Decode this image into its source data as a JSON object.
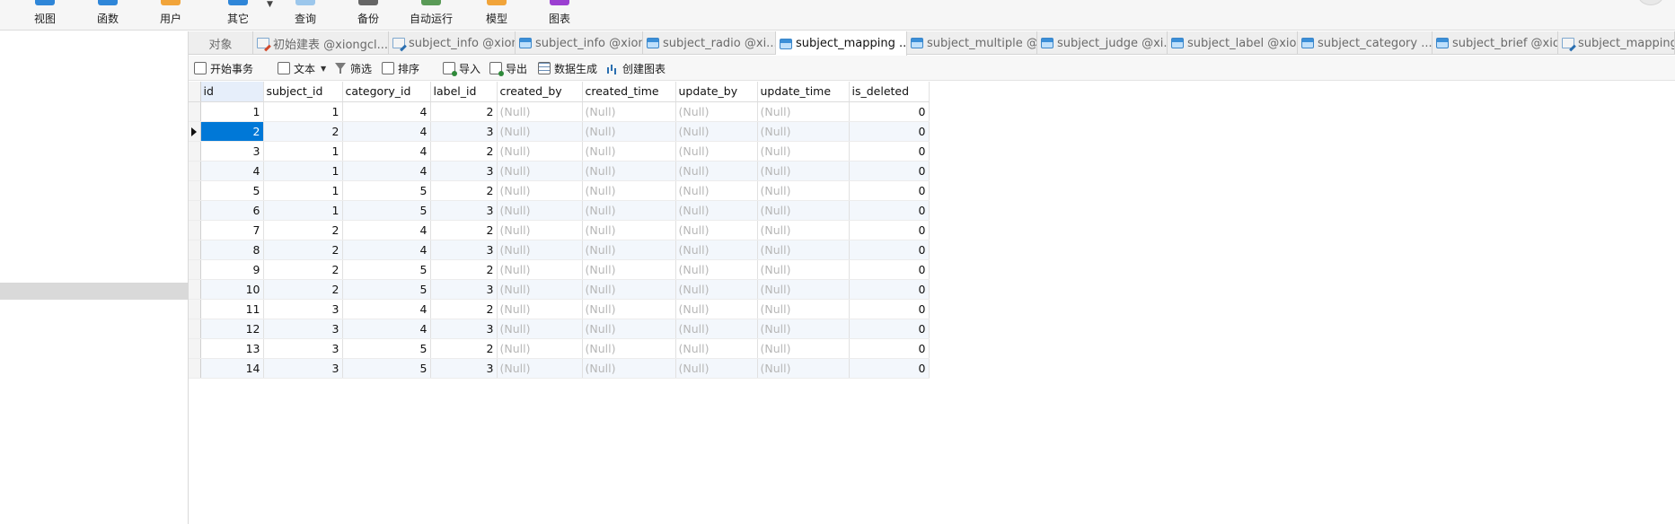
{
  "ribbon": {
    "buttons": [
      {
        "label": "视图",
        "icon": "view-icon",
        "color": "#2f86d8"
      },
      {
        "label": "函数",
        "icon": "function-icon",
        "color": "#2f86d8"
      },
      {
        "label": "用户",
        "icon": "user-icon",
        "color": "#f1a43a"
      },
      {
        "label": "其它",
        "icon": "other-icon",
        "color": "#2f86d8"
      },
      {
        "label": "查询",
        "icon": "query-icon",
        "color": "#9cc7ec"
      },
      {
        "label": "备份",
        "icon": "backup-icon",
        "color": "#666666"
      },
      {
        "label": "自动运行",
        "icon": "automation-icon",
        "color": "#5a9a57"
      },
      {
        "label": "模型",
        "icon": "model-icon",
        "color": "#f1a43a"
      },
      {
        "label": "图表",
        "icon": "chart-icon",
        "color": "#9b3fd1"
      }
    ]
  },
  "tabs": [
    {
      "label": "对象",
      "icon": "none"
    },
    {
      "label": "初始建表 @xiongcl...",
      "icon": "query-red"
    },
    {
      "label": "subject_info @xion...",
      "icon": "query"
    },
    {
      "label": "subject_info @xion...",
      "icon": "table"
    },
    {
      "label": "subject_radio @xi...",
      "icon": "table"
    },
    {
      "label": "subject_mapping ...",
      "icon": "table",
      "active": true
    },
    {
      "label": "subject_multiple @...",
      "icon": "table"
    },
    {
      "label": "subject_judge @xi...",
      "icon": "table"
    },
    {
      "label": "subject_label @xio...",
      "icon": "table"
    },
    {
      "label": "subject_category ...",
      "icon": "table"
    },
    {
      "label": "subject_brief @xio...",
      "icon": "table"
    },
    {
      "label": "subject_mapping ...",
      "icon": "query"
    }
  ],
  "toolbar": {
    "begin_transaction": "开始事务",
    "text": "文本",
    "filter": "筛选",
    "sort": "排序",
    "import": "导入",
    "export": "导出",
    "generate_data": "数据生成",
    "create_chart": "创建图表"
  },
  "grid": {
    "columns": [
      "id",
      "subject_id",
      "category_id",
      "label_id",
      "created_by",
      "created_time",
      "update_by",
      "update_time",
      "is_deleted"
    ],
    "null_text": "(Null)",
    "selected_row": 1,
    "rows": [
      [
        "1",
        "1",
        "4",
        "2",
        "0"
      ],
      [
        "2",
        "2",
        "4",
        "3",
        "0"
      ],
      [
        "3",
        "1",
        "4",
        "2",
        "0"
      ],
      [
        "4",
        "1",
        "4",
        "3",
        "0"
      ],
      [
        "5",
        "1",
        "5",
        "2",
        "0"
      ],
      [
        "6",
        "1",
        "5",
        "3",
        "0"
      ],
      [
        "7",
        "2",
        "4",
        "2",
        "0"
      ],
      [
        "8",
        "2",
        "4",
        "3",
        "0"
      ],
      [
        "9",
        "2",
        "5",
        "2",
        "0"
      ],
      [
        "10",
        "2",
        "5",
        "3",
        "0"
      ],
      [
        "11",
        "3",
        "4",
        "2",
        "0"
      ],
      [
        "12",
        "3",
        "4",
        "3",
        "0"
      ],
      [
        "13",
        "3",
        "5",
        "2",
        "0"
      ],
      [
        "14",
        "3",
        "5",
        "3",
        "0"
      ]
    ]
  }
}
